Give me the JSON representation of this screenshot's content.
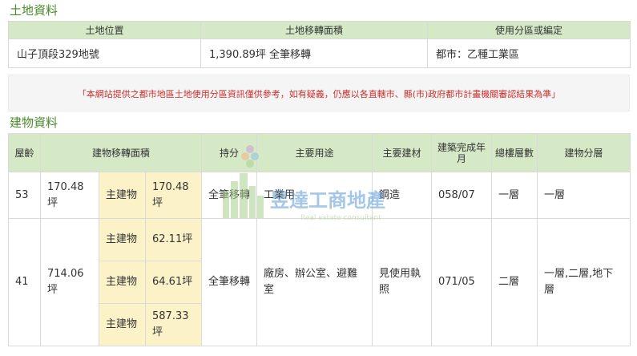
{
  "land": {
    "section_title": "土地資料",
    "headers": [
      "土地位置",
      "土地移轉面積",
      "使用分區或編定"
    ],
    "row": [
      "山子頂段329地號",
      "1,390.89坪 全筆移轉",
      "都市：乙種工業區"
    ]
  },
  "notice": "「本網站提供之都市地區土地使用分區資訊僅供參考，如有疑義，仍應以各直轄市、縣(市)政府都市計畫機關審認結果為準」",
  "building": {
    "section_title": "建物資料",
    "headers": {
      "age": "屋齡",
      "area": "建物移轉面積",
      "share": "持分",
      "use": "主要用途",
      "material": "主要建材",
      "built": "建築完成年月",
      "floors": "總樓層數",
      "floor_level": "建物分層"
    },
    "rows": [
      {
        "age": "53",
        "area": "170.48坪",
        "subs": [
          {
            "label": "主建物",
            "value": "170.48坪"
          }
        ],
        "share": "全筆移轉",
        "use": "工業用",
        "material": "鋼造",
        "built": "058/07",
        "floors": "一層",
        "floor_level": "一層"
      },
      {
        "age": "41",
        "area": "714.06坪",
        "subs": [
          {
            "label": "主建物",
            "value": "62.11坪"
          },
          {
            "label": "主建物",
            "value": "64.61坪"
          },
          {
            "label": "主建物",
            "value": "587.33坪"
          }
        ],
        "share": "全筆移轉",
        "use": "廠房、辦公室、避難室",
        "material": "見使用執照",
        "built": "071/05",
        "floors": "二層",
        "floor_level": "一層,二層,地下層"
      }
    ]
  },
  "watermark": {
    "name": "昱達工商地產",
    "sub": "Real estate consultant"
  },
  "colors": {
    "accent_green": "#4a8a2e",
    "header_bg": "#d5e9c6",
    "sub_bg": "#fcf2c8",
    "notice_red": "#c9302c"
  }
}
